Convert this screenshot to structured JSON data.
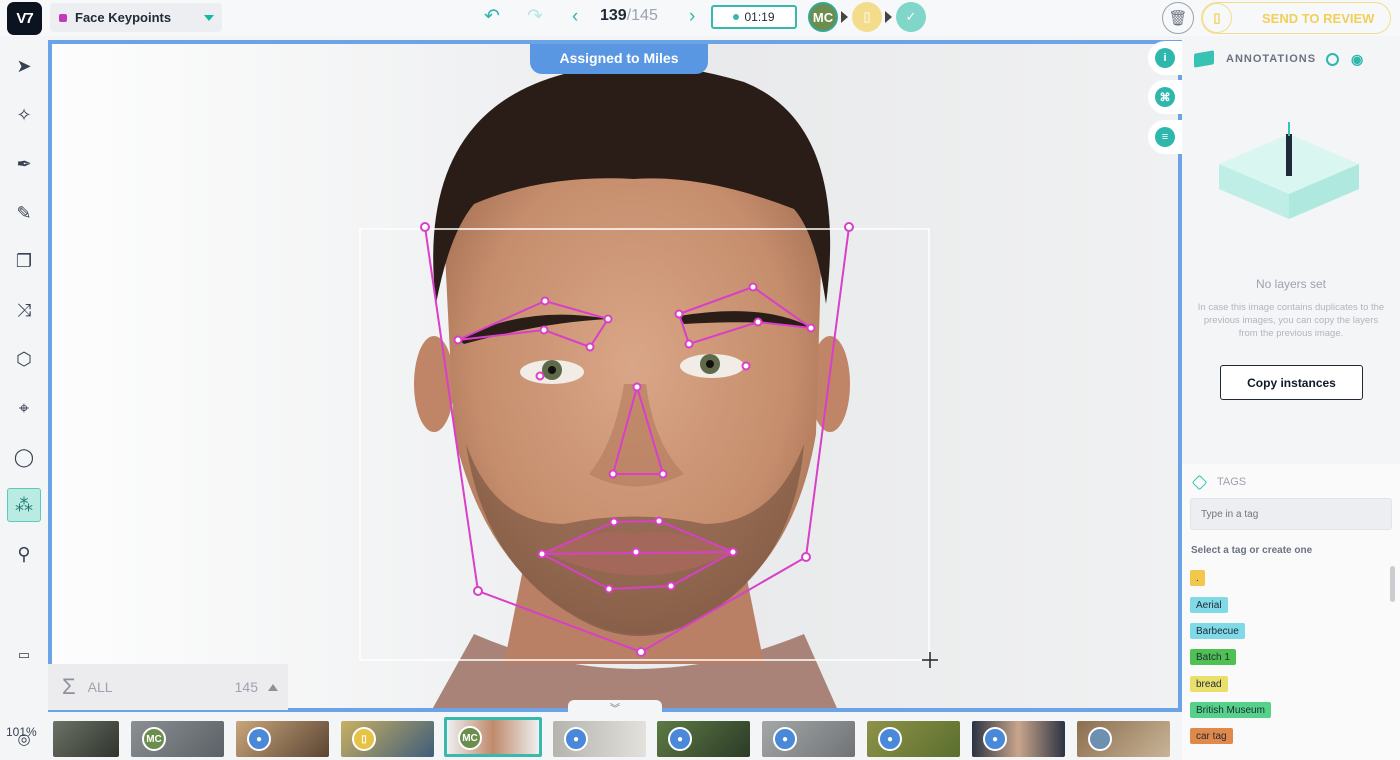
{
  "app": {
    "logo": "V7",
    "dataset": "Face Keypoints"
  },
  "topbar": {
    "counter_current": "139",
    "counter_total": "/145",
    "timer": "01:19",
    "assignee_initials": "MC",
    "send_review": "SEND TO REVIEW",
    "icons": [
      "undo-icon",
      "redo-icon",
      "chevron-left-icon",
      "chevron-right-icon",
      "clipboard-icon",
      "check-icon",
      "trash-icon"
    ]
  },
  "canvas": {
    "assigned_label": "Assigned to Miles"
  },
  "leftbar": {
    "tools": [
      "select-arrow-icon",
      "auto-annotate-icon",
      "polygon-pen-icon",
      "brush-icon",
      "clone-icon",
      "line-icon",
      "cuboid-icon",
      "keypoint-icon",
      "ellipse-icon",
      "skeleton-icon",
      "zoom-tool-icon"
    ],
    "zoom": "101%"
  },
  "bottom": {
    "filter_label": "ALL",
    "count": "145",
    "thumb_avatar": "MC"
  },
  "annotations": {
    "title": "ANNOTATIONS",
    "empty_title": "No layers set",
    "empty_hint": "In case this image contains duplicates to the previous images, you can copy the layers from the previous image.",
    "copy_button": "Copy instances"
  },
  "tags": {
    "title": "TAGS",
    "placeholder": "Type in a tag",
    "subtitle": "Select a tag or create one",
    "items": [
      {
        "label": ".",
        "color": "#f3c64d"
      },
      {
        "label": "Aerial",
        "color": "#7fd9e6"
      },
      {
        "label": "Barbecue",
        "color": "#7fd9e6"
      },
      {
        "label": "Batch 1",
        "color": "#4fc152"
      },
      {
        "label": "bread",
        "color": "#e8e06a"
      },
      {
        "label": "British Museum",
        "color": "#55d18a"
      },
      {
        "label": "car tag",
        "color": "#e0894b"
      }
    ]
  },
  "colors": {
    "accent": "#2fb7ae",
    "canvas_border": "#6ba4e6",
    "keypoints": "#d93fc8",
    "review": "#f2cf59"
  }
}
